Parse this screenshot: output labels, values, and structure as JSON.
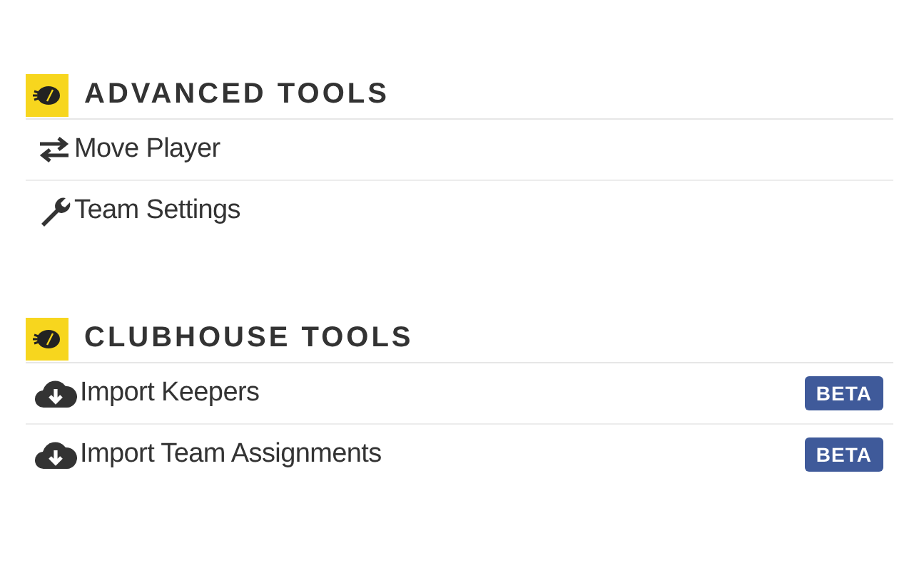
{
  "sections": [
    {
      "title": "ADVANCED TOOLS",
      "items": [
        {
          "label": "Move Player",
          "kind": "move"
        },
        {
          "label": "Team Settings",
          "kind": "settings"
        }
      ]
    },
    {
      "title": "CLUBHOUSE TOOLS",
      "items": [
        {
          "label": "Import Keepers",
          "kind": "import",
          "badge": "BETA"
        },
        {
          "label": "Import Team Assignments",
          "kind": "import",
          "badge": "BETA"
        }
      ]
    }
  ]
}
